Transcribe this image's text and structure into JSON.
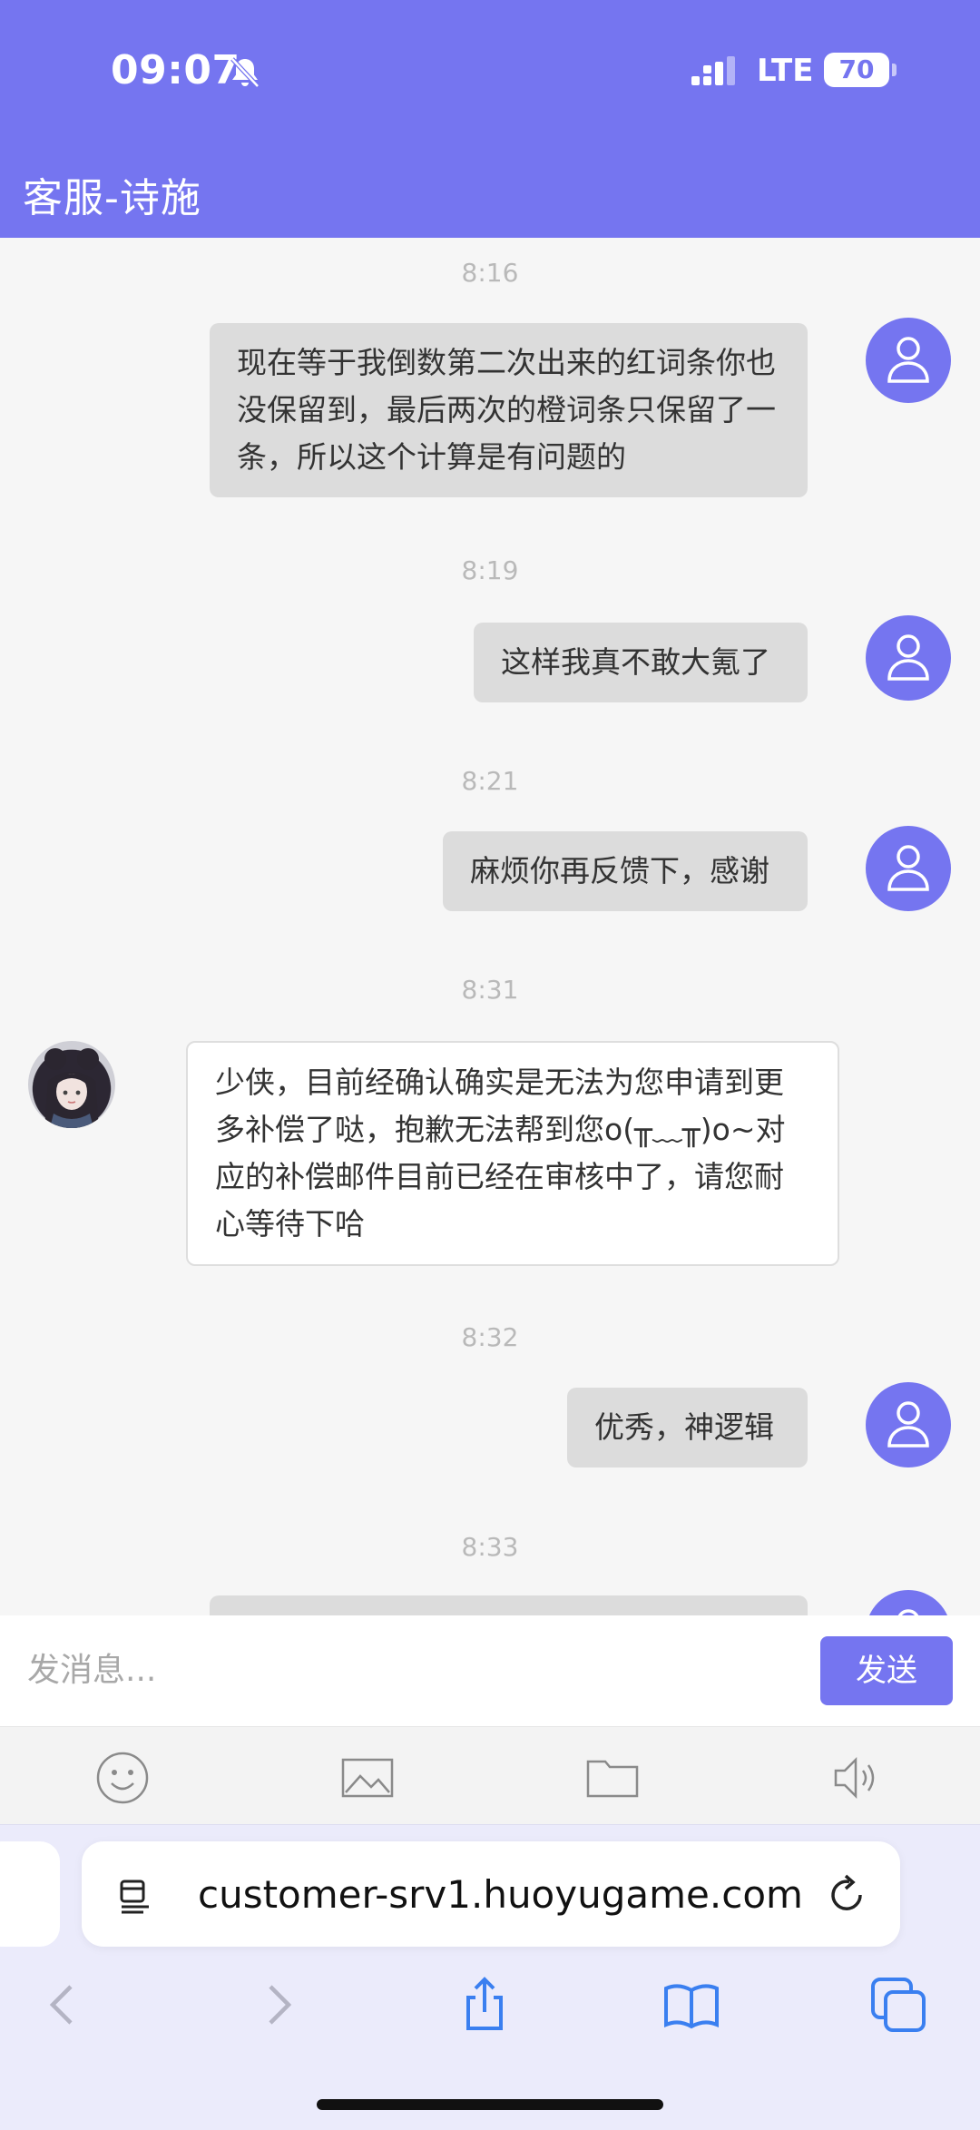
{
  "status_bar": {
    "time": "09:07",
    "network": "LTE",
    "battery": "70",
    "icons": [
      "bell-slash-icon",
      "signal-icon",
      "battery-icon"
    ]
  },
  "header": {
    "title": "客服-诗施"
  },
  "colors": {
    "brand": "#7575f0",
    "chat_background": "#f6f6f6",
    "outgoing_bubble": "#dcdcdc",
    "incoming_bubble": "#ffffff",
    "timestamp": "#b9b9b9"
  },
  "chat": {
    "messages": [
      {
        "time": "8:16",
        "sender": "user",
        "text": "现在等于我倒数第二次出来的红词条你也没保留到，最后两次的橙词条只保留了一条，所以这个计算是有问题的"
      },
      {
        "time": "8:19",
        "sender": "user",
        "text": "这样我真不敢大氪了"
      },
      {
        "time": "8:21",
        "sender": "user",
        "text": "麻烦你再反馈下，感谢"
      },
      {
        "time": "8:31",
        "sender": "agent",
        "text": "少侠，目前经确认确实是无法为您申请到更多补偿了哒，抱歉无法帮到您o(╥﹏╥)o~对应的补偿邮件目前已经在审核中了，请您耐心等待下哈"
      },
      {
        "time": "8:32",
        "sender": "user",
        "text": "优秀，神逻辑"
      },
      {
        "time": "8:33",
        "sender": "user",
        "text": ""
      }
    ]
  },
  "composer": {
    "placeholder": "发消息...",
    "send_label": "发送"
  },
  "toolbar": {
    "items": [
      "emoji-icon",
      "image-icon",
      "folder-icon",
      "voice-icon"
    ]
  },
  "browser": {
    "url": "customer-srv1.huoyugame.com",
    "nav_items": [
      "back-icon",
      "forward-icon",
      "share-icon",
      "bookmarks-icon",
      "tabs-icon"
    ]
  }
}
